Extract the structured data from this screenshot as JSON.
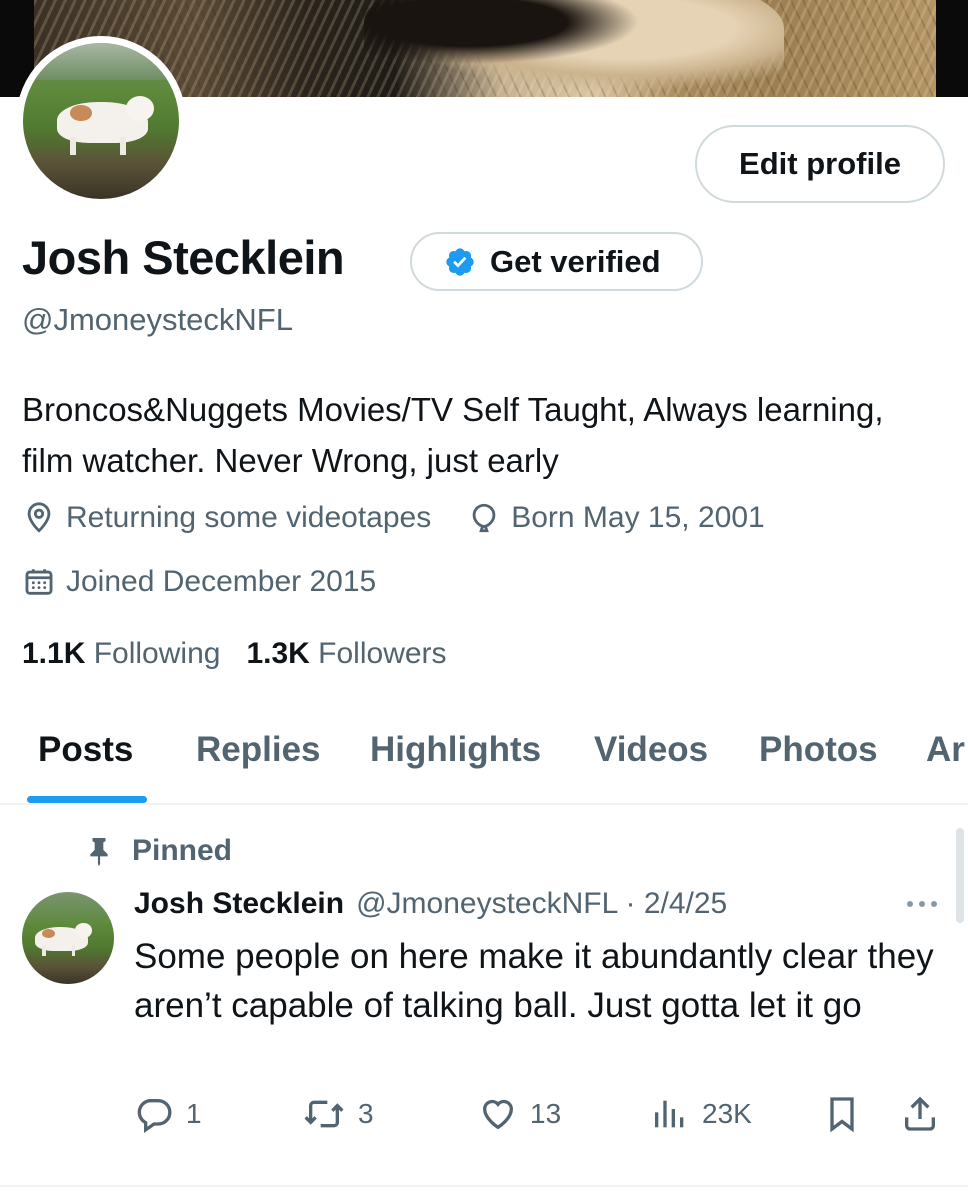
{
  "profile": {
    "name": "Josh Stecklein",
    "handle": "@JmoneysteckNFL",
    "bio": "Broncos&Nuggets Movies/TV Self Taught, Always learning, film watcher. Never Wrong, just early",
    "location": "Returning some videotapes",
    "birthday": "Born May 15, 2001",
    "joined": "Joined December 2015",
    "following_count": "1.1K",
    "following_label": "Following",
    "followers_count": "1.3K",
    "followers_label": "Followers"
  },
  "buttons": {
    "edit_profile": "Edit profile",
    "get_verified": "Get verified"
  },
  "tabs": [
    {
      "label": "Posts",
      "active": true
    },
    {
      "label": "Replies",
      "active": false
    },
    {
      "label": "Highlights",
      "active": false
    },
    {
      "label": "Videos",
      "active": false
    },
    {
      "label": "Photos",
      "active": false
    },
    {
      "label": "Ar",
      "active": false
    }
  ],
  "post": {
    "pinned_label": "Pinned",
    "author_name": "Josh Stecklein",
    "author_handle_date": "@JmoneysteckNFL · 2/4/25",
    "text": "Some people on here make it abundantly clear they aren’t capable of talking ball. Just gotta let it go",
    "replies": "1",
    "reposts": "3",
    "likes": "13",
    "views": "23K"
  },
  "icons": {
    "location": "location-pin-icon",
    "birthday": "balloon-icon",
    "joined": "calendar-icon",
    "verified": "verified-badge-icon",
    "pin": "pin-icon",
    "more": "more-icon",
    "reply": "reply-icon",
    "repost": "repost-icon",
    "like": "heart-icon",
    "views": "views-icon",
    "bookmark": "bookmark-icon",
    "share": "share-icon"
  },
  "colors": {
    "accent": "#1d9bf0",
    "text_primary": "#0f1419",
    "text_secondary": "#536471",
    "border": "#cfd9de"
  }
}
